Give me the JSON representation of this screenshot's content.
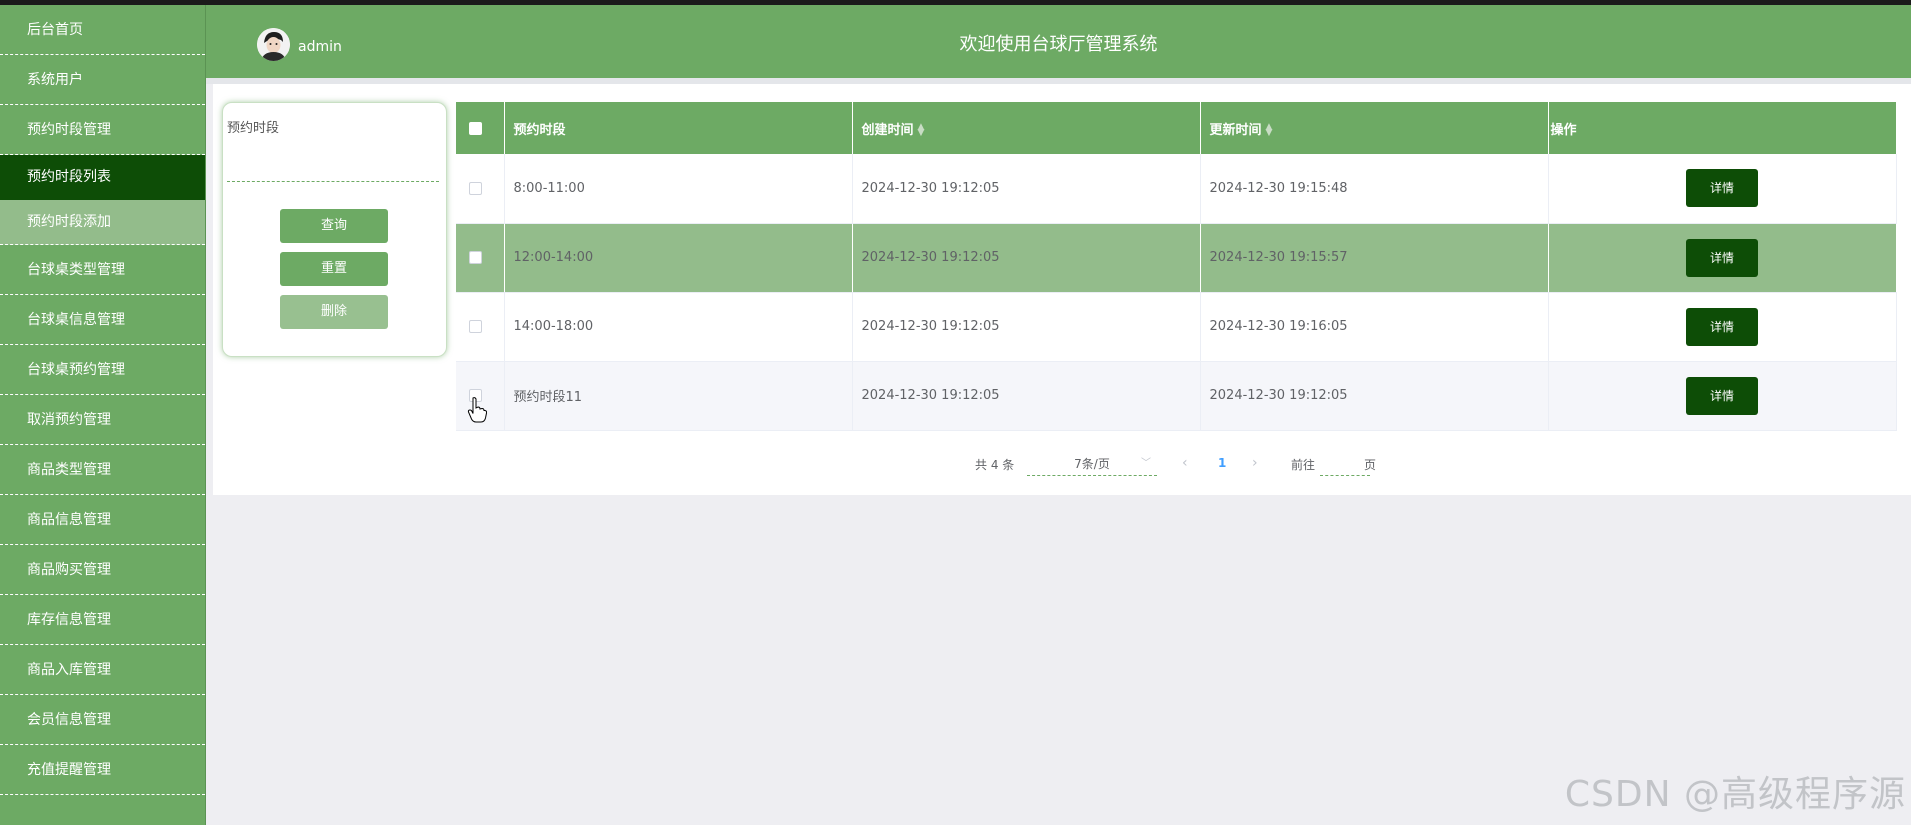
{
  "sidebar": {
    "items": [
      {
        "label": "后台首页"
      },
      {
        "label": "系统用户"
      },
      {
        "label": "预约时段管理"
      },
      {
        "label": "预约时段列表"
      },
      {
        "label": "预约时段添加"
      },
      {
        "label": "台球桌类型管理"
      },
      {
        "label": "台球桌信息管理"
      },
      {
        "label": "台球桌预约管理"
      },
      {
        "label": "取消预约管理"
      },
      {
        "label": "商品类型管理"
      },
      {
        "label": "商品信息管理"
      },
      {
        "label": "商品购买管理"
      },
      {
        "label": "库存信息管理"
      },
      {
        "label": "商品入库管理"
      },
      {
        "label": "会员信息管理"
      },
      {
        "label": "充值提醒管理"
      }
    ]
  },
  "header": {
    "username": "admin",
    "title": "欢迎使用台球厅管理系统"
  },
  "search": {
    "field_label": "预约时段",
    "field_value": "",
    "query_label": "查询",
    "reset_label": "重置",
    "delete_label": "删除"
  },
  "table": {
    "headers": {
      "slot": "预约时段",
      "created": "创建时间",
      "updated": "更新时间",
      "actions": "操作"
    },
    "detail_label": "详情",
    "rows": [
      {
        "slot": "8:00-11:00",
        "created": "2024-12-30 19:12:05",
        "updated": "2024-12-30 19:15:48"
      },
      {
        "slot": "12:00-14:00",
        "created": "2024-12-30 19:12:05",
        "updated": "2024-12-30 19:15:57"
      },
      {
        "slot": "14:00-18:00",
        "created": "2024-12-30 19:12:05",
        "updated": "2024-12-30 19:16:05"
      },
      {
        "slot": "预约时段11",
        "created": "2024-12-30 19:12:05",
        "updated": "2024-12-30 19:12:05"
      }
    ]
  },
  "pagination": {
    "total": "共 4 条",
    "page_size": "7条/页",
    "current_page": "1",
    "goto_prefix": "前往",
    "goto_suffix": "页",
    "goto_value": ""
  },
  "watermark": "CSDN @高级程序源",
  "colors": {
    "primary": "#6daa64",
    "active_menu": "#0d4d06",
    "highlight_row": "#93bc8b",
    "detail_button": "#0d4d06"
  },
  "icons": [
    "avatar",
    "sort-caret-icon",
    "chevron-down-icon",
    "chevron-left-icon",
    "chevron-right-icon",
    "pointer-cursor-icon"
  ]
}
